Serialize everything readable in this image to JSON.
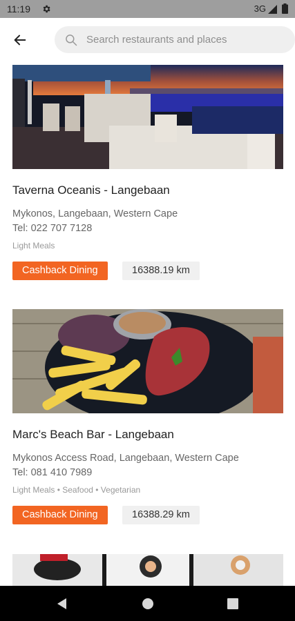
{
  "status_bar": {
    "time": "11:19",
    "network": "3G",
    "icons": [
      "gear-icon",
      "signal-icon",
      "battery-icon"
    ]
  },
  "header": {
    "back_icon": "arrow-left-icon",
    "search_placeholder": "Search restaurants and places"
  },
  "restaurants": [
    {
      "name": "Taverna Oceanis - Langebaan",
      "address": "Mykonos, Langebaan, Western Cape",
      "phone": "Tel: 022 707 7128",
      "categories": "Light Meals",
      "badge": "Cashback Dining",
      "distance": "16388.19 km"
    },
    {
      "name": "Marc's Beach Bar - Langebaan",
      "address": "Mykonos Access Road, Langebaan, Western Cape",
      "phone": "Tel: 081 410 7989",
      "categories": "Light Meals • Seafood • Vegetarian",
      "badge": "Cashback Dining",
      "distance": "16388.29 km"
    }
  ],
  "nav": {
    "icons": [
      "back-triangle-icon",
      "home-circle-icon",
      "recents-square-icon"
    ]
  },
  "colors": {
    "accent": "#f26522",
    "status_bar": "#9e9e9e",
    "nav_bar": "#000000"
  }
}
